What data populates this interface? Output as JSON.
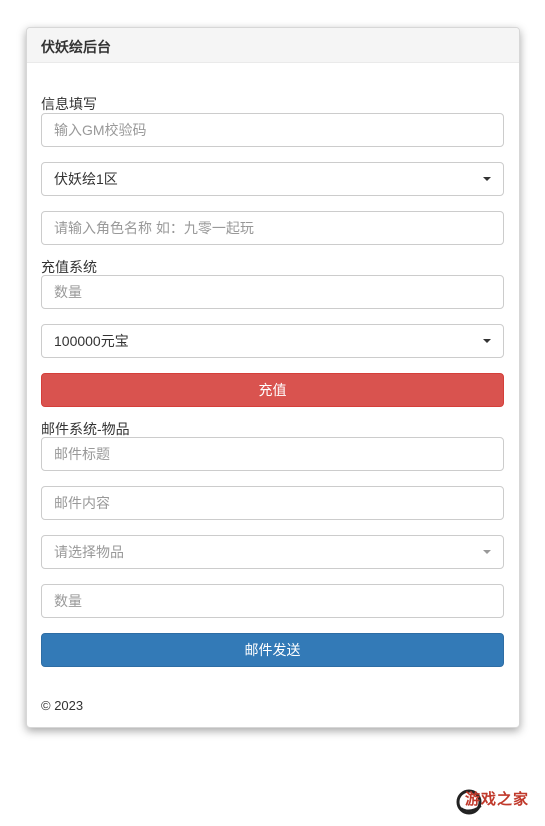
{
  "panel": {
    "title": "伏妖绘后台"
  },
  "info": {
    "label": "信息填写",
    "gm_code_placeholder": "输入GM校验码",
    "server_select": "伏妖绘1区",
    "role_placeholder": "请输入角色名称 如：九零一起玩"
  },
  "recharge": {
    "label": "充值系统",
    "amount_placeholder": "数量",
    "package_select": "100000元宝",
    "button": "充值"
  },
  "mail": {
    "label": "邮件系统-物品",
    "title_placeholder": "邮件标题",
    "content_placeholder": "邮件内容",
    "item_placeholder": "请选择物品",
    "quantity_placeholder": "数量",
    "button": "邮件发送"
  },
  "footer": {
    "copyright": "© 2023"
  },
  "watermark": {
    "text": "游戏之家"
  },
  "colors": {
    "recharge_button": "#d9534f",
    "mail_button": "#337ab7",
    "heading_bg": "#f5f5f5"
  }
}
